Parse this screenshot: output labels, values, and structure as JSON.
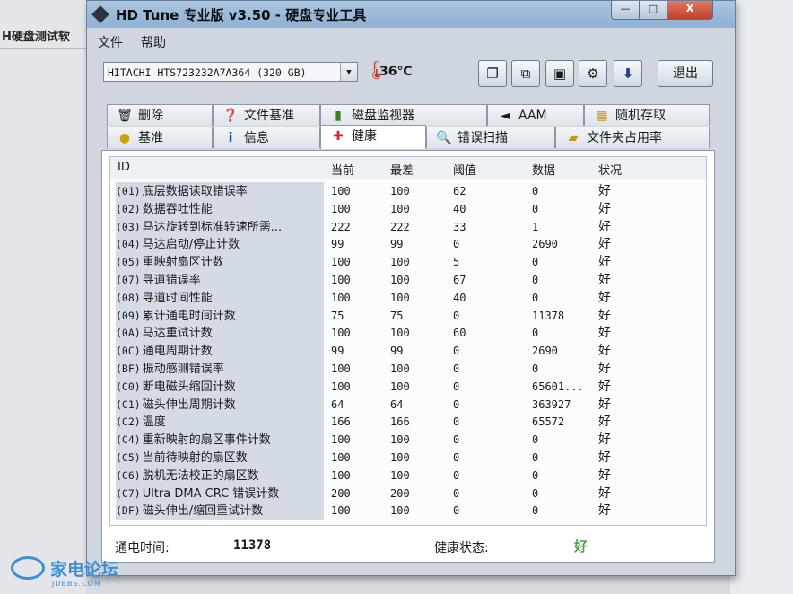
{
  "background": {
    "left_title": "H硬盘测试软"
  },
  "window": {
    "title": "HD Tune 专业版 v3.50 - 硬盘专业工具",
    "min_label": "—",
    "max_label": "□",
    "close_label": "X"
  },
  "menu": {
    "file": "文件",
    "help": "帮助"
  },
  "drive": {
    "selected": "HITACHI HTS723232A7A364 (320 GB)",
    "temperature": "36℃"
  },
  "toolbar": {
    "exit_label": "退出"
  },
  "tabs": {
    "row1": [
      {
        "label": "删除",
        "icon": "trash-icon"
      },
      {
        "label": "文件基准",
        "icon": "file-benchmark-icon"
      },
      {
        "label": "磁盘监视器",
        "icon": "bar-chart-icon"
      },
      {
        "label": "AAM",
        "icon": "speaker-icon"
      },
      {
        "label": "随机存取",
        "icon": "random-access-icon"
      }
    ],
    "row2": [
      {
        "label": "基准",
        "icon": "lightbulb-icon"
      },
      {
        "label": "信息",
        "icon": "info-icon"
      },
      {
        "label": "健康",
        "icon": "red-cross-icon"
      },
      {
        "label": "错误扫描",
        "icon": "magnifier-icon"
      },
      {
        "label": "文件夹占用率",
        "icon": "folder-icon"
      }
    ],
    "active": "健康"
  },
  "table": {
    "headers": {
      "id": "ID",
      "current": "当前",
      "worst": "最差",
      "threshold": "阈值",
      "data": "数据",
      "status": "状况"
    },
    "rows": [
      {
        "code": "(01)",
        "name": "底层数据读取错误率",
        "current": "100",
        "worst": "100",
        "threshold": "62",
        "data": "0",
        "status": "好"
      },
      {
        "code": "(02)",
        "name": "数据吞吐性能",
        "current": "100",
        "worst": "100",
        "threshold": "40",
        "data": "0",
        "status": "好"
      },
      {
        "code": "(03)",
        "name": "马达旋转到标准转速所需...",
        "current": "222",
        "worst": "222",
        "threshold": "33",
        "data": "1",
        "status": "好"
      },
      {
        "code": "(04)",
        "name": "马达启动/停止计数",
        "current": "99",
        "worst": "99",
        "threshold": "0",
        "data": "2690",
        "status": "好"
      },
      {
        "code": "(05)",
        "name": "重映射扇区计数",
        "current": "100",
        "worst": "100",
        "threshold": "5",
        "data": "0",
        "status": "好"
      },
      {
        "code": "(07)",
        "name": "寻道错误率",
        "current": "100",
        "worst": "100",
        "threshold": "67",
        "data": "0",
        "status": "好"
      },
      {
        "code": "(08)",
        "name": "寻道时间性能",
        "current": "100",
        "worst": "100",
        "threshold": "40",
        "data": "0",
        "status": "好"
      },
      {
        "code": "(09)",
        "name": "累计通电时间计数",
        "current": "75",
        "worst": "75",
        "threshold": "0",
        "data": "11378",
        "status": "好"
      },
      {
        "code": "(0A)",
        "name": "马达重试计数",
        "current": "100",
        "worst": "100",
        "threshold": "60",
        "data": "0",
        "status": "好"
      },
      {
        "code": "(0C)",
        "name": "通电周期计数",
        "current": "99",
        "worst": "99",
        "threshold": "0",
        "data": "2690",
        "status": "好"
      },
      {
        "code": "(BF)",
        "name": "振动感测错误率",
        "current": "100",
        "worst": "100",
        "threshold": "0",
        "data": "0",
        "status": "好"
      },
      {
        "code": "(C0)",
        "name": "断电磁头缩回计数",
        "current": "100",
        "worst": "100",
        "threshold": "0",
        "data": "65601...",
        "status": "好"
      },
      {
        "code": "(C1)",
        "name": "磁头伸出周期计数",
        "current": "64",
        "worst": "64",
        "threshold": "0",
        "data": "363927",
        "status": "好"
      },
      {
        "code": "(C2)",
        "name": "温度",
        "current": "166",
        "worst": "166",
        "threshold": "0",
        "data": "65572",
        "status": "好"
      },
      {
        "code": "(C4)",
        "name": "重新映射的扇区事件计数",
        "current": "100",
        "worst": "100",
        "threshold": "0",
        "data": "0",
        "status": "好"
      },
      {
        "code": "(C5)",
        "name": "当前待映射的扇区数",
        "current": "100",
        "worst": "100",
        "threshold": "0",
        "data": "0",
        "status": "好"
      },
      {
        "code": "(C6)",
        "name": "脱机无法校正的扇区数",
        "current": "100",
        "worst": "100",
        "threshold": "0",
        "data": "0",
        "status": "好"
      },
      {
        "code": "(C7)",
        "name": "Ultra DMA CRC 错误计数",
        "current": "200",
        "worst": "200",
        "threshold": "0",
        "data": "0",
        "status": "好"
      },
      {
        "code": "(DF)",
        "name": "磁头伸出/缩回重试计数",
        "current": "100",
        "worst": "100",
        "threshold": "0",
        "data": "0",
        "status": "好"
      }
    ]
  },
  "footer": {
    "power_on_label": "通电时间:",
    "power_on_value": "11378",
    "health_label": "健康状态:",
    "health_value": "好"
  },
  "watermark": {
    "text": "家电论坛",
    "sub": "JDBBS.COM"
  },
  "colors": {
    "status_ok": "#4aa646",
    "titlebar": "#9bbcdc",
    "close_button": "#c1412a",
    "id_highlight": "#d5dbe4"
  }
}
